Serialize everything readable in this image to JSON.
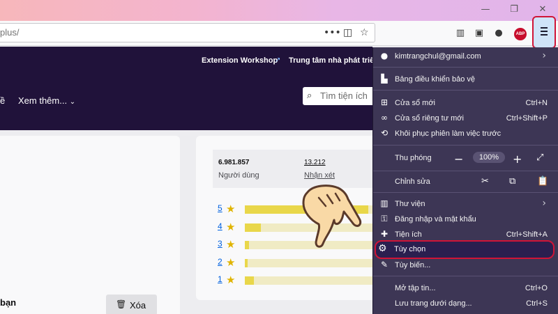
{
  "window": {
    "minimize_glyph": "—",
    "restore_glyph": "❐",
    "close_glyph": "✕"
  },
  "url": {
    "text": "plus/"
  },
  "toolbar": {
    "icons": [
      "page-actions-icon",
      "pocket-icon",
      "bookmark-star-icon",
      "library-icon",
      "sidebar-icon",
      "account-icon",
      "adblock-plus-icon",
      "hamburger-menu-icon"
    ],
    "abp_label": "ABP"
  },
  "site": {
    "header_links": [
      "Extension Workshop",
      "Trung tâm nhà phát triể"
    ],
    "nav_partial": "ề",
    "nav_more": "Xem thêm...",
    "search_placeholder": "Tìm tiện ích"
  },
  "addon_card": {
    "partial_text": "bạn",
    "delete_label": "Xóa"
  },
  "stats": {
    "users_value": "6.981.857",
    "users_label": "Người dùng",
    "reviews_value": "13.212",
    "reviews_label": "Nhận xét"
  },
  "ratings": [
    {
      "stars": "5",
      "fraction": 0.93
    },
    {
      "stars": "4",
      "fraction": 0.12
    },
    {
      "stars": "3",
      "fraction": 0.03
    },
    {
      "stars": "2",
      "fraction": 0.02
    },
    {
      "stars": "1",
      "fraction": 0.07
    }
  ],
  "app_menu": {
    "account": "kimtrangchul@gmail.com",
    "protection_dashboard": "Bảng điều khiển bảo vệ",
    "new_window": {
      "label": "Cửa sổ mới",
      "shortcut": "Ctrl+N"
    },
    "private_window": {
      "label": "Cửa sổ riêng tư mới",
      "shortcut": "Ctrl+Shift+P"
    },
    "restore_session": "Khôi phục phiên làm việc trước",
    "zoom": {
      "label": "Thu phóng",
      "value": "100%"
    },
    "edit": "Chỉnh sửa",
    "library": "Thư viện",
    "logins": "Đăng nhập và mật khẩu",
    "addons": {
      "label": "Tiện ích",
      "shortcut": "Ctrl+Shift+A"
    },
    "options": "Tùy chọn",
    "customize": "Tùy biến...",
    "open_file": {
      "label": "Mở tập tin...",
      "shortcut": "Ctrl+O"
    },
    "save_page": {
      "label": "Lưu trang dưới dạng...",
      "shortcut": "Ctrl+S"
    }
  },
  "colors": {
    "menu_bg": "#3d3655",
    "header_bg": "#20123a",
    "highlight_border": "#d01437",
    "rating_fill": "#e9d74a",
    "hand_fill": "#f9d9a6"
  }
}
